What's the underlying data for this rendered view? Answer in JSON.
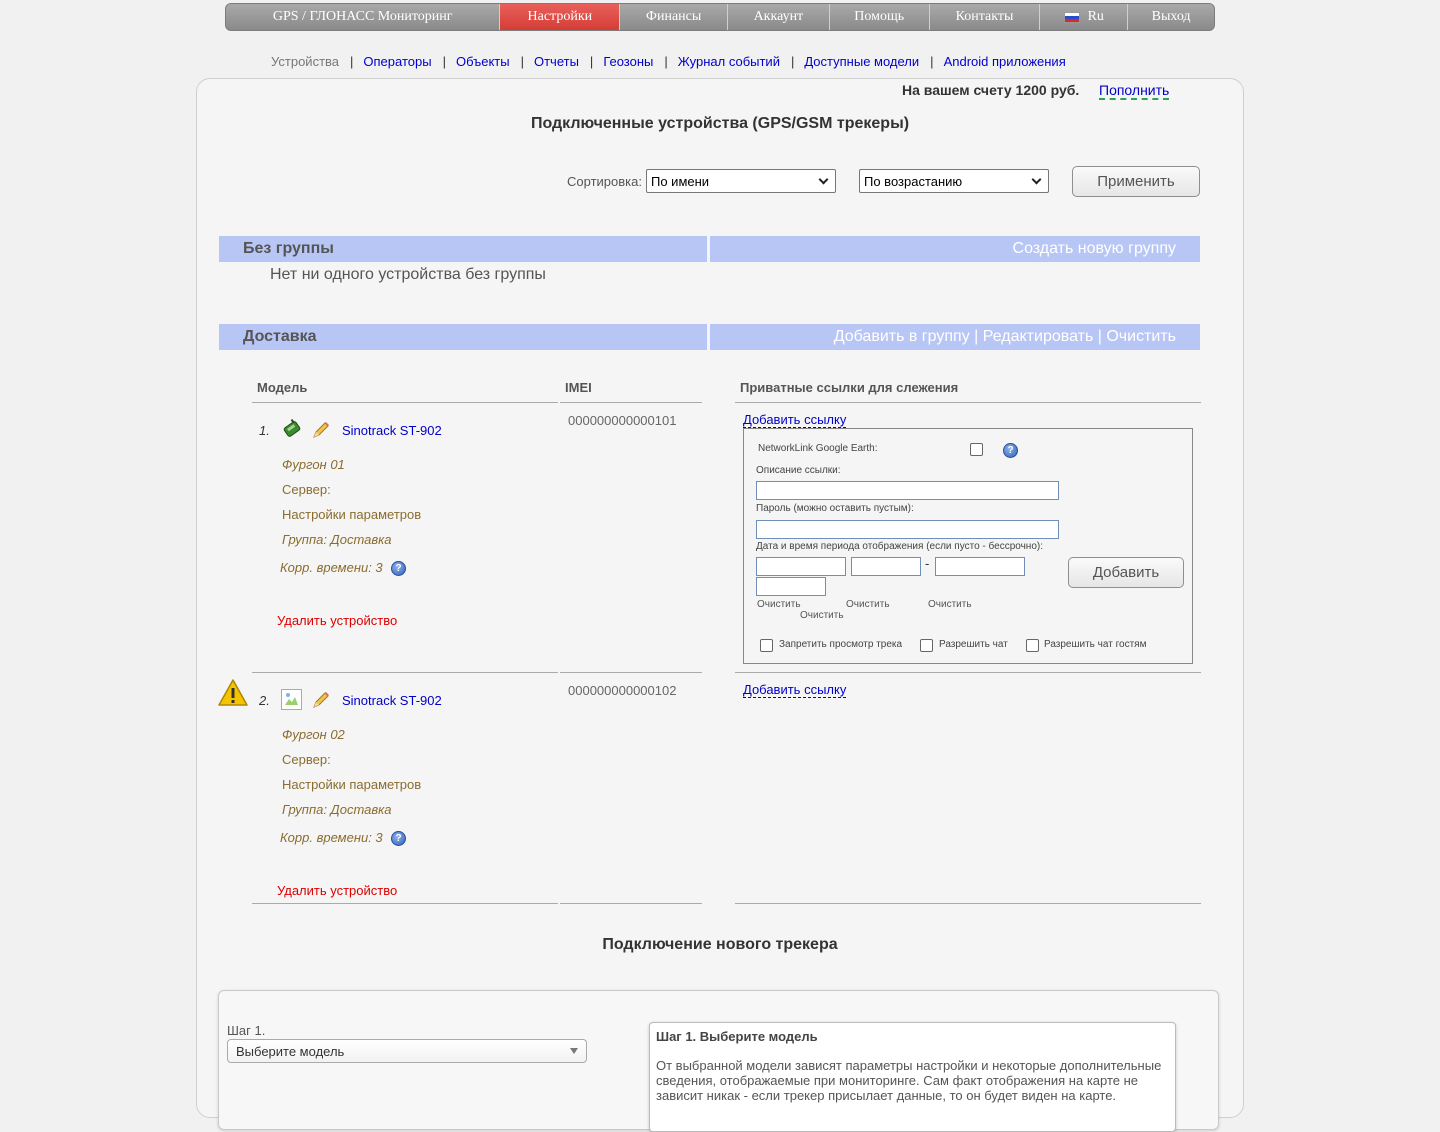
{
  "topnav": [
    {
      "label": "GPS / ГЛОНАСС Мониторинг",
      "active": false
    },
    {
      "label": "Настройки",
      "active": true
    },
    {
      "label": "Финансы",
      "active": false
    },
    {
      "label": "Аккаунт",
      "active": false
    },
    {
      "label": "Помощь",
      "active": false
    },
    {
      "label": "Контакты",
      "active": false
    },
    {
      "label": "Ru",
      "active": false
    },
    {
      "label": "Выход",
      "active": false
    }
  ],
  "subnav": [
    "Устройства",
    "Операторы",
    "Объекты",
    "Отчеты",
    "Геозоны",
    "Журнал событий",
    "Доступные модели",
    "Android приложения"
  ],
  "balance": {
    "text": "На вашем счету 1200 руб.",
    "topup": "Пополнить"
  },
  "page_title": "Подключенные устройства (GPS/GSM трекеры)",
  "sort": {
    "label": "Сортировка:",
    "field": "По имени",
    "order": "По возрастанию",
    "apply": "Применить"
  },
  "groups": {
    "nogroup": {
      "name": "Без группы",
      "action": "Создать новую группу",
      "empty": "Нет ни одного устройства без группы"
    },
    "delivery": {
      "name": "Доставка",
      "add": "Добавить в группу",
      "edit": "Редактировать",
      "clear": "Очистить",
      "sep": "|"
    }
  },
  "columns": {
    "model": "Модель",
    "imei": "IMEI",
    "links": "Приватные ссылки для слежения"
  },
  "devices": [
    {
      "num": "1.",
      "model": "Sinotrack ST-902",
      "name": "Фургон 01",
      "server": "Сервер:",
      "params": "Настройки параметров",
      "group": "Группа: Доставка",
      "tz": "Корр. времени: 3",
      "delete": "Удалить устройство",
      "imei": "000000000000101",
      "add_link": "Добавить ссылку"
    },
    {
      "num": "2.",
      "model": "Sinotrack ST-902",
      "name": "Фургон 02",
      "server": "Сервер:",
      "params": "Настройки параметров",
      "group": "Группа: Доставка",
      "tz": "Корр. времени: 3",
      "delete": "Удалить устройство",
      "imei": "000000000000102",
      "add_link": "Добавить ссылку"
    }
  ],
  "linkform": {
    "networklink": "NetworkLink Google Earth:",
    "desc": "Описание ссылки:",
    "password": "Пароль (можно оставить пустым):",
    "period": "Дата и время периода отображения (если пусто - бессрочно):",
    "dash": "-",
    "clear": "Очистить",
    "add": "Добавить",
    "forbid_track": "Запретить просмотр трека",
    "allow_chat": "Разрешить чат",
    "allow_guest_chat": "Разрешить чат гостям"
  },
  "new_tracker": {
    "title": "Подключение нового трекера",
    "step_label": "Шаг 1.",
    "select_placeholder": "Выберите модель",
    "info_title": "Шаг 1. Выберите модель",
    "info_text": "От выбранной модели зависят параметры настройки и некоторые дополнительные сведения, отображаемые при мониторинге. Сам факт отображения на карте не зависит никак - если трекер присылает данные, то он будет виден на карте."
  },
  "colors": {
    "active_tab": "#d43d36",
    "group_bar": "#b8c6f5",
    "link": "#0000cc",
    "delete": "#dd0000",
    "meta": "#8a6d2e"
  },
  "icons": [
    "flag-ru-icon",
    "device-icon",
    "edit-pencil-icon",
    "help-icon",
    "warning-icon",
    "broken-image-icon",
    "select-chevron-icon"
  ]
}
